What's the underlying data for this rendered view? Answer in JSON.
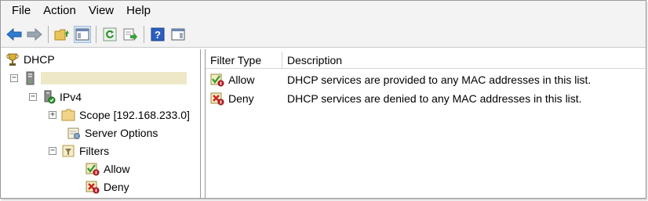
{
  "menu": [
    "File",
    "Action",
    "View",
    "Help"
  ],
  "toolbar": {
    "icons": [
      "back-arrow-icon",
      "forward-arrow-icon",
      "up-folder-icon",
      "show-hide-tree-icon",
      "refresh-icon",
      "export-list-icon",
      "help-icon",
      "properties-pane-icon"
    ]
  },
  "tree": {
    "root": "DHCP",
    "server": "",
    "ipv4": "IPv4",
    "scope": "Scope [192.168.233.0]",
    "server_options": "Server Options",
    "filters": "Filters",
    "allow": "Allow",
    "deny": "Deny"
  },
  "list": {
    "columns": [
      "Filter Type",
      "Description"
    ],
    "rows": [
      {
        "type": "Allow",
        "description": "DHCP services are provided to any MAC addresses in this list."
      },
      {
        "type": "Deny",
        "description": "DHCP services are denied to any MAC addresses in this list."
      }
    ]
  },
  "colors": {
    "chrome": "#f3f3f3",
    "hostname_highlight": "#efe8c8",
    "border": "#9a9a9a"
  }
}
